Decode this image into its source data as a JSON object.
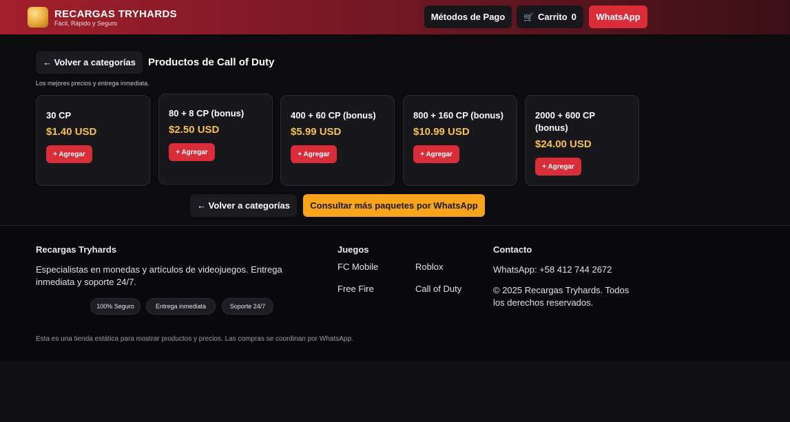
{
  "header": {
    "brand_title": "RECARGAS TRYHARDS",
    "brand_sub": "Fácil, Rápido y Seguro",
    "pay_label": "Métodos de Pago",
    "cart_icon": "cart-icon",
    "cart_label": "Carrito",
    "cart_count": "0",
    "whatsapp_label": "WhatsApp"
  },
  "main": {
    "back_label": "← Volver a categorías",
    "title": "Productos de Call of Duty",
    "subtitle": "Los mejores precios y entrega inmediata.",
    "add_label": "+ Agregar",
    "products": [
      {
        "name": "30 CP",
        "price": "$1.40 USD"
      },
      {
        "name": "80 + 8 CP (bonus)",
        "price": "$2.50 USD"
      },
      {
        "name": "400 + 60 CP (bonus)",
        "price": "$5.99 USD"
      },
      {
        "name": "800 + 160 CP (bonus)",
        "price": "$10.99 USD"
      },
      {
        "name": "2000 + 600 CP (bonus)",
        "price": "$24.00 USD"
      }
    ],
    "back_bottom_label": "← Volver a categorías",
    "consult_label": "Consultar más paquetes por WhatsApp"
  },
  "footer": {
    "about_title": "Recargas Tryhards",
    "about_text": "Especialistas en monedas y artículos de videojuegos. Entrega inmediata y soporte 24/7.",
    "chips": [
      "100% Seguro",
      "Entrega inmediata",
      "Soporte 24/7"
    ],
    "games_title": "Juegos",
    "games": [
      "FC Mobile",
      "Roblox",
      "Free Fire",
      "Call of Duty"
    ],
    "contact_title": "Contacto",
    "contact_whatsapp": "WhatsApp: +58 412 744 2672",
    "copyright": "© 2025 Recargas Tryhards. Todos los derechos reservados.",
    "note": "Esta es una tienda estática para mostrar productos y precios. Las compras se coordinan por WhatsApp."
  },
  "colors": {
    "accent_red": "#d92d3a",
    "price_gold": "#f7c14e",
    "consult_orange": "#f7a31c"
  }
}
